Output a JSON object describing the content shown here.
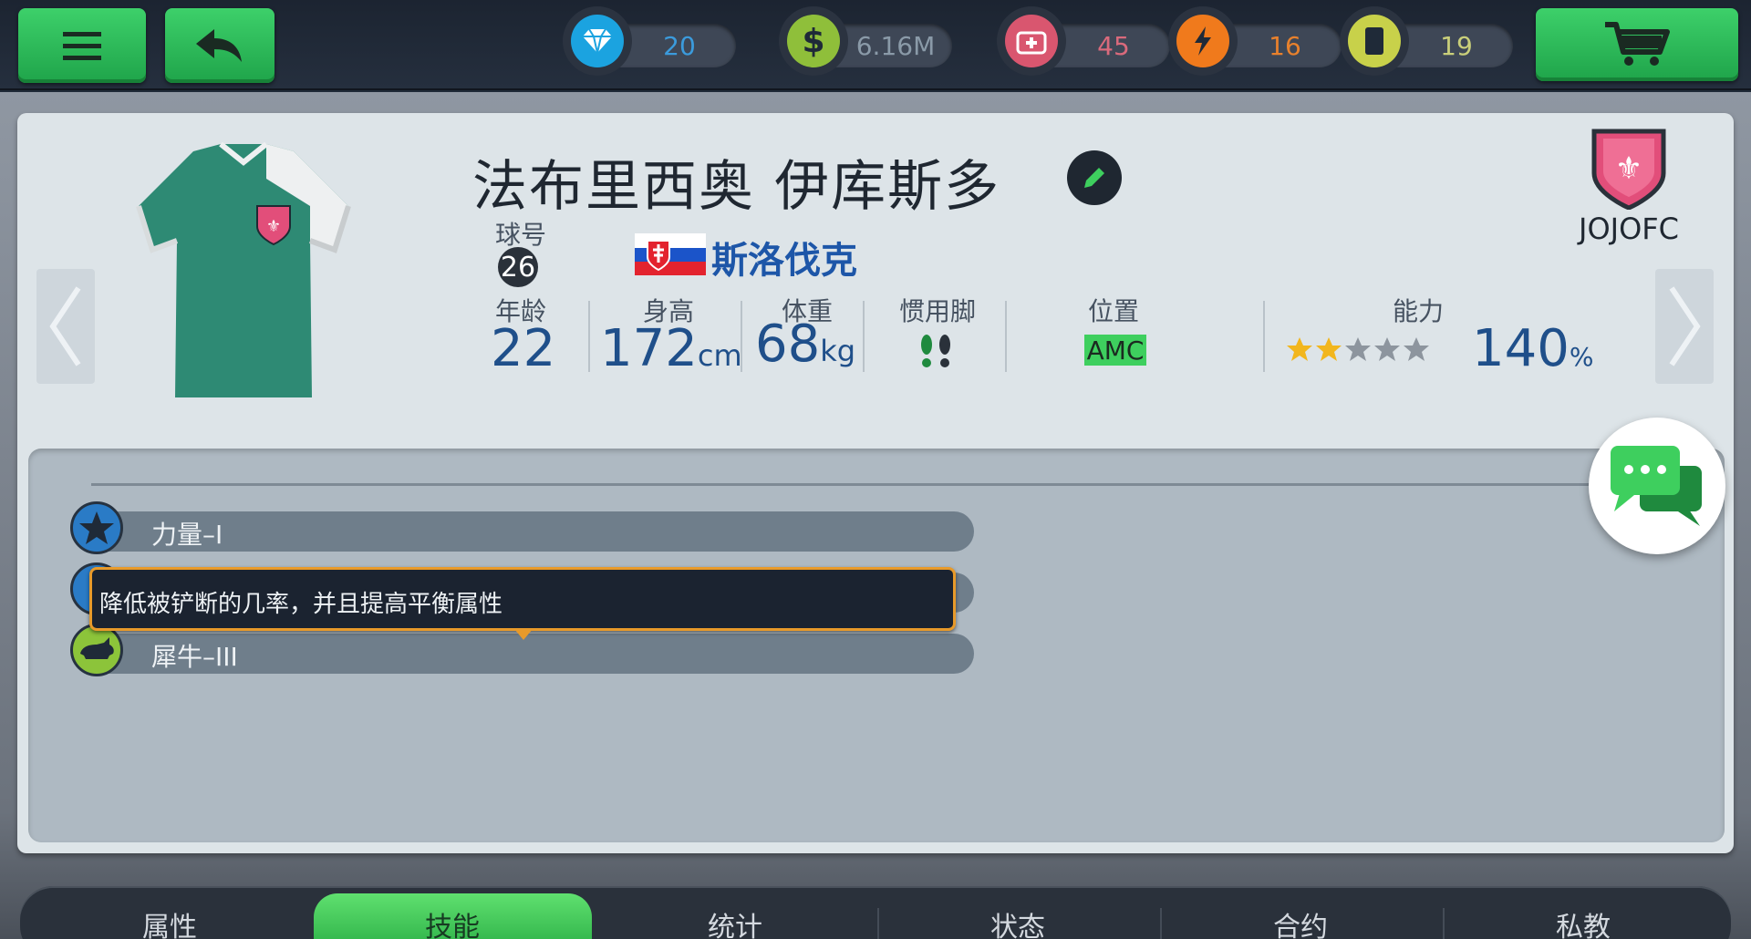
{
  "resources": [
    {
      "name": "diamonds",
      "icon": "diamond-icon",
      "value": "20",
      "color": "#1ba3e0",
      "text_color": "#3b9bdc"
    },
    {
      "name": "money",
      "icon": "dollar-icon",
      "value": "6.16M",
      "color": "#8fbf3a",
      "text_color": "#8a9aa8"
    },
    {
      "name": "medical",
      "icon": "medkit-icon",
      "value": "45",
      "color": "#d9566f",
      "text_color": "#d96a7c"
    },
    {
      "name": "energy",
      "icon": "lightning-icon",
      "value": "16",
      "color": "#f07a1c",
      "text_color": "#e8812c"
    },
    {
      "name": "cards",
      "icon": "card-icon",
      "value": "19",
      "color": "#c8d14a",
      "text_color": "#c9cf7a"
    }
  ],
  "player": {
    "name": "法布里西奥 伊库斯多",
    "number_label": "球号",
    "number": "26",
    "nationality": "斯洛伐克",
    "age_label": "年龄",
    "age": "22",
    "height_label": "身高",
    "height": "172",
    "height_unit": "cm",
    "weight_label": "体重",
    "weight": "68",
    "weight_unit": "kg",
    "foot_label": "惯用脚",
    "position_label": "位置",
    "position": "AMC",
    "ability_label": "能力",
    "stars": 2,
    "stars_max": 5,
    "ability_value": "140",
    "ability_unit": "%"
  },
  "club": {
    "name": "JOJOFC"
  },
  "skills": [
    {
      "label": "力量–I",
      "icon": "star-icon"
    },
    {
      "label": "",
      "icon": "skill-icon"
    },
    {
      "label": "犀牛–III",
      "icon": "rhino-icon"
    }
  ],
  "tooltip": "降低被铲断的几率，并且提高平衡属性",
  "tabs": [
    "属性",
    "技能",
    "统计",
    "状态",
    "合约",
    "私教"
  ],
  "active_tab": 1,
  "colors": {
    "accent_green": "#33c463",
    "tooltip_border": "#e89a2a",
    "value_blue": "#1f4f8a"
  }
}
